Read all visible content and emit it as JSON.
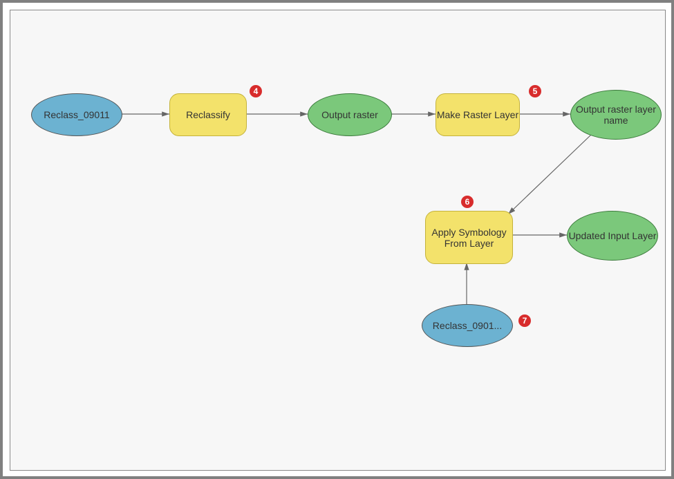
{
  "diagram": {
    "nodes": {
      "input1": {
        "label": "Reclass_09011"
      },
      "reclassify": {
        "label": "Reclassify"
      },
      "outRaster": {
        "label": "Output raster"
      },
      "makeRaster": {
        "label": "Make Raster Layer"
      },
      "outLayerName": {
        "label": "Output raster layer name"
      },
      "applySym": {
        "label": "Apply Symbology From Layer"
      },
      "updatedLayer": {
        "label": "Updated Input Layer"
      },
      "input2": {
        "label": "Reclass_0901..."
      }
    },
    "badges": {
      "b4": "4",
      "b5": "5",
      "b6": "6",
      "b7": "7"
    }
  }
}
